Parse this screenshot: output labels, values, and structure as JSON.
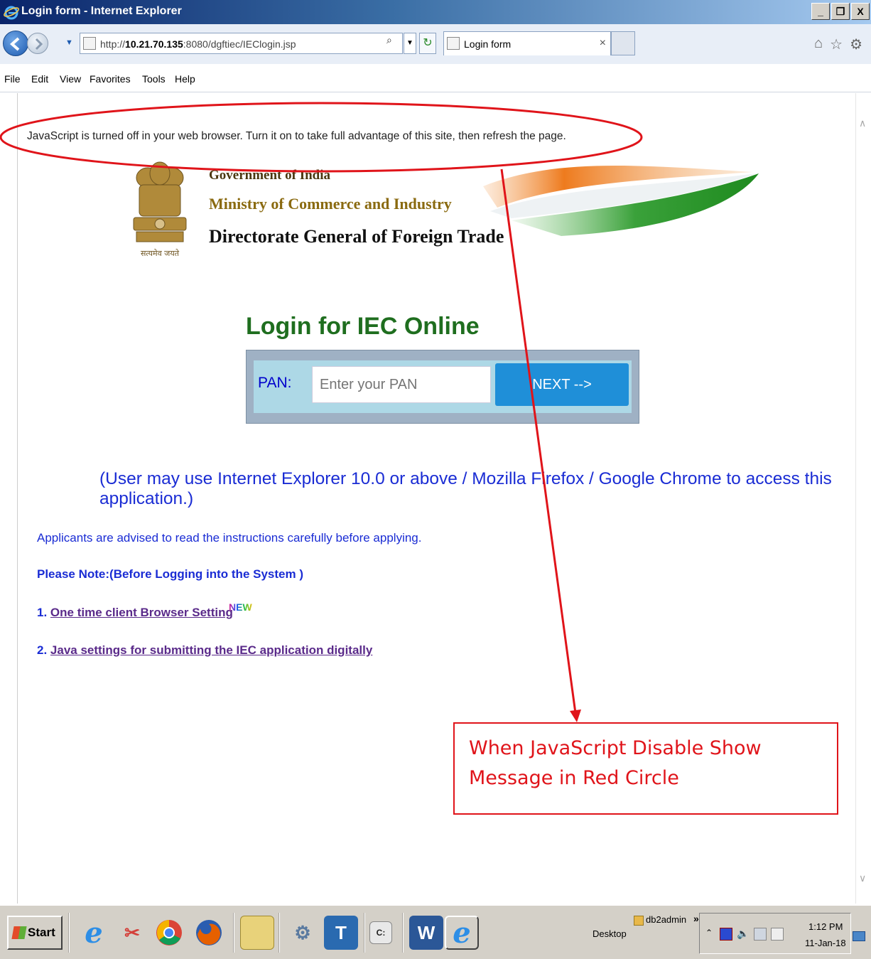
{
  "window": {
    "title": "Login form - Internet Explorer",
    "controls": [
      "_",
      "❒",
      "X"
    ]
  },
  "browser": {
    "url_prefix": "http://",
    "url_host": "10.21.70.135",
    "url_rest": ":8080/dgftiec/IEClogin.jsp",
    "tab_label": "Login form",
    "tab_close": "×"
  },
  "menu": [
    "File",
    "Edit",
    "View",
    "Favorites",
    "Tools",
    "Help"
  ],
  "page": {
    "js_warning": "JavaScript is turned off in your web browser. Turn it on to take full advantage of this site, then refresh the page.",
    "header": {
      "line1": "Government of India",
      "line2": "Ministry of Commerce and Industry",
      "line3": "Directorate General of Foreign Trade",
      "emblem_motto": "सत्यमेव जयते"
    },
    "login": {
      "title": "Login for IEC Online",
      "pan_label": "PAN:",
      "pan_placeholder": "Enter your PAN",
      "pan_value": "",
      "next_label": "NEXT -->"
    },
    "browser_note": "(User may use Internet Explorer 10.0 or above / Mozilla Firefox / Google Chrome to access this application.)",
    "advise": "Applicants are advised to read the instructions carefully before applying.",
    "please_note": "Please Note:(Before Logging into the System )",
    "links": [
      {
        "num": "1. ",
        "text": "One time client Browser Setting"
      },
      {
        "num": "2. ",
        "text": "Java settings for submitting the IEC application digitally"
      }
    ],
    "new_badge": "NEW"
  },
  "annotation": {
    "callout_text": "When JavaScript Disable Show Message in Red Circle",
    "color": "#e0141a"
  },
  "taskbar": {
    "start_label": "Start",
    "desktop_label": "Desktop",
    "user_label": "db2admin",
    "more": "»",
    "clock_time": "1:12 PM",
    "clock_date": "11-Jan-18"
  },
  "colors": {
    "link_blue": "#1a2cd4",
    "title_green": "#1f6e1f",
    "next_button": "#1f8fd8",
    "login_panel": "#add8e6"
  }
}
